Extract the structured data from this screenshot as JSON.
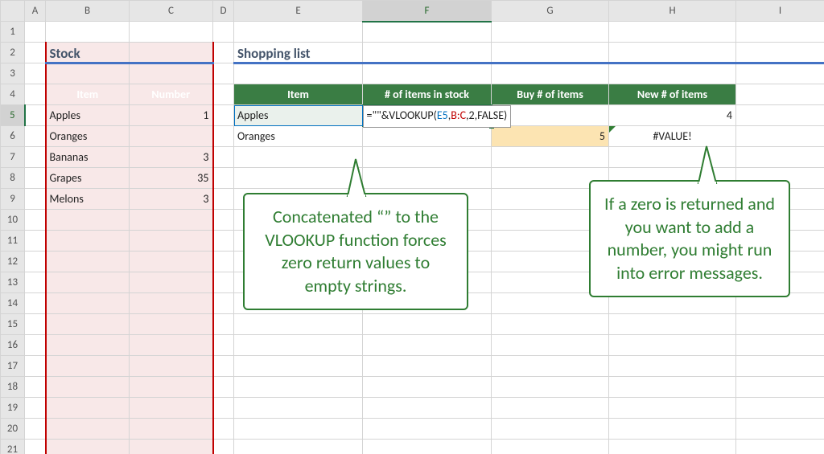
{
  "columns": {
    "A": "A",
    "B": "B",
    "C": "C",
    "D": "D",
    "E": "E",
    "F": "F",
    "G": "G",
    "H": "H",
    "I": "I"
  },
  "sections": {
    "stock_title": "Stock",
    "shopping_title": "Shopping list"
  },
  "stock_headers": {
    "item": "Item",
    "number": "Number"
  },
  "shopping_headers": {
    "item": "Item",
    "f": "# of items in stock",
    "g": "Buy # of items",
    "h": "New # of items"
  },
  "stock_rows": [
    {
      "item": "Apples",
      "num": "1"
    },
    {
      "item": "Oranges",
      "num": ""
    },
    {
      "item": "Bananas",
      "num": "3"
    },
    {
      "item": "Grapes",
      "num": "35"
    },
    {
      "item": "Melons",
      "num": "3"
    }
  ],
  "shopping_rows": [
    {
      "item": "Apples",
      "g": "",
      "h": "4"
    },
    {
      "item": "Oranges",
      "g": "5",
      "h": "#VALUE!"
    }
  ],
  "formula": {
    "pre": "=\"\"&VLOOKUP(",
    "a1": "E5",
    "c1": ",",
    "a2": "B:C",
    "rest": ",2,FALSE)"
  },
  "callouts": {
    "left": "Concatenated “” to the VLOOKUP function forces zero return values to empty strings.",
    "right": "If a zero is returned and you want to add a number, you might run into error messages."
  },
  "active": {
    "col": "F",
    "row": "5"
  }
}
